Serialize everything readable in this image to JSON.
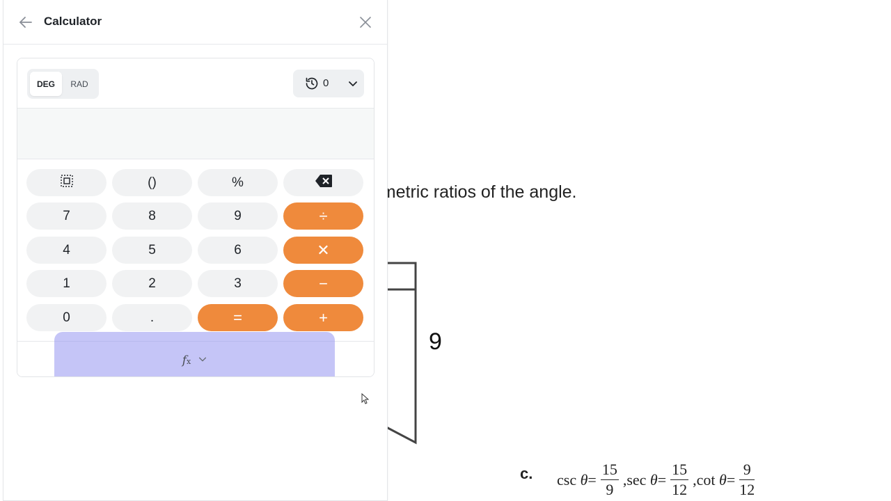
{
  "document": {
    "instruction_fragment": "nometric ratios of the angle.",
    "triangle_side": "9",
    "option_label": "c.",
    "formula": {
      "csc": {
        "fn": "csc",
        "num": "15",
        "den": "9",
        "sep": ","
      },
      "sec": {
        "fn": "sec",
        "num": "15",
        "den": "12",
        "sep": ","
      },
      "cot": {
        "fn": "cot",
        "num": "9",
        "den": "12",
        "sep": ""
      },
      "theta": "θ",
      "eq": "="
    }
  },
  "panel": {
    "title": "Calculator",
    "back_icon": "arrow-left-icon",
    "close_icon": "close-icon"
  },
  "calculator": {
    "mode": {
      "deg": "DEG",
      "rad": "RAD",
      "selected": "DEG"
    },
    "history": {
      "icon": "history-icon",
      "count": "0",
      "chevron": "chevron-down-icon"
    },
    "display_value": "",
    "keys": {
      "r1": {
        "special": "select-all-icon",
        "parens": "()",
        "percent": "%",
        "backspace": "backspace-icon"
      },
      "r2": {
        "k7": "7",
        "k8": "8",
        "k9": "9",
        "divide": "÷"
      },
      "r3": {
        "k4": "4",
        "k5": "5",
        "k6": "6",
        "multiply": "✕"
      },
      "r4": {
        "k1": "1",
        "k2": "2",
        "k3": "3",
        "minus": "−"
      },
      "r5": {
        "k0": "0",
        "dot": ".",
        "equals": "=",
        "plus": "+"
      }
    },
    "functions": {
      "label": "f",
      "sub": "x",
      "chevron": "chevron-down-icon"
    },
    "accent_color": "#ef8a3c",
    "highlight_color": "#8c8cf0"
  }
}
